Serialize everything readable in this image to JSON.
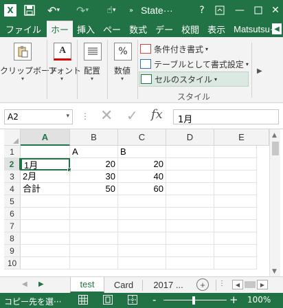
{
  "titlebar": {
    "app_logo": "X",
    "title": "State···",
    "help": "?",
    "colors": {
      "brand": "#217346"
    }
  },
  "tabs": [
    "ファイル",
    "ホー",
    "挿入",
    "ペー",
    "数式",
    "デー",
    "校閲",
    "表示",
    "Matsutsu···"
  ],
  "ribbon": {
    "clipboard": "クリップボード",
    "font": "フォント",
    "align": "配置",
    "number": "数値",
    "number_symbol": "%",
    "font_symbol": "A",
    "conditional": "条件付き書式",
    "table_format": "テーブルとして書式設定",
    "cell_style": "セルのスタイル",
    "group_style": "スタイル"
  },
  "formula_bar": {
    "name_box": "A2",
    "fx": "fx",
    "content": "1月"
  },
  "grid": {
    "columns": [
      "A",
      "B",
      "C",
      "D",
      "E"
    ],
    "rows": [
      "1",
      "2",
      "3",
      "4",
      "5",
      "6",
      "7",
      "8",
      "9",
      "10"
    ],
    "cells": {
      "B1": "A",
      "C1": "B",
      "A2": "1月",
      "B2": "20",
      "C2": "20",
      "A3": "2月",
      "B3": "30",
      "C3": "40",
      "A4": "合計",
      "B4": "50",
      "C4": "60"
    },
    "active_cell": "A2"
  },
  "sheets": [
    "test",
    "Card",
    "2017 ..."
  ],
  "active_sheet": "test",
  "add_sheet": "+",
  "statusbar": {
    "text": "コピー先を選···",
    "zoom": "100%",
    "zoom_minus": "-",
    "zoom_plus": "+"
  }
}
